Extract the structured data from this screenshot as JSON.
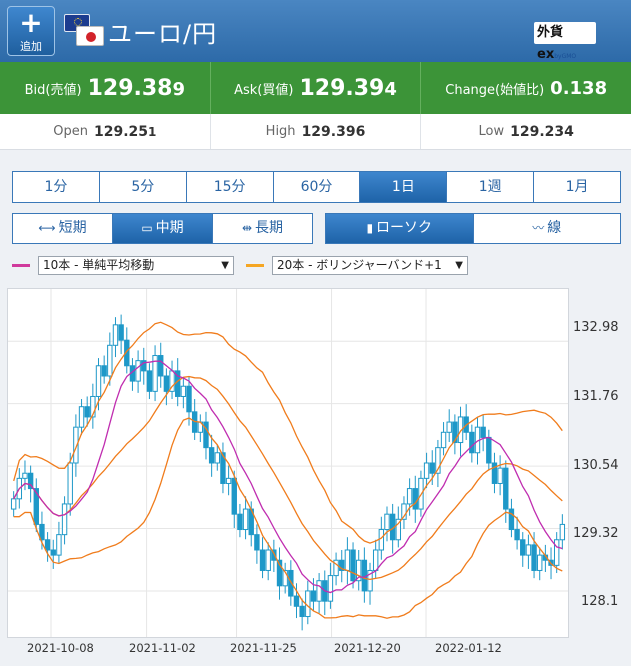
{
  "header": {
    "add_label": "追加",
    "title": "ユーロ/円",
    "brand": "外貨ex",
    "brand_sub": "byGMO"
  },
  "prices": {
    "bid_label": "Bid(売値)",
    "bid_main": "129.38",
    "bid_tail": "9",
    "ask_label": "Ask(買値)",
    "ask_main": "129.39",
    "ask_tail": "4",
    "change_label": "Change(始値比)",
    "change_value": "0.138",
    "open_label": "Open",
    "open_main": "129.25",
    "open_tail": "1",
    "high_label": "High",
    "high_value": "129.396",
    "low_label": "Low",
    "low_value": "129.234"
  },
  "timeframes": [
    "1分",
    "5分",
    "15分",
    "60分",
    "1日",
    "1週",
    "1月"
  ],
  "active_timeframe": "1日",
  "terms": {
    "short": "短期",
    "mid": "中期",
    "long": "長期",
    "active": "中期"
  },
  "chart_styles": {
    "candle": "ローソク",
    "line": "線",
    "active": "ローソク"
  },
  "indicators": [
    {
      "label": "10本 - 単純平均移動",
      "color": "#d03a9c"
    },
    {
      "label": "20本 - ボリンジャーバンド+1",
      "color": "#f5a623"
    }
  ],
  "colors": {
    "header": "#2d6aa8",
    "price_bar": "#3c9438",
    "candle": "#1e98c8",
    "sma": "#c02db0",
    "bollinger": "#f07c1c"
  },
  "chart_data": {
    "type": "candlestick",
    "y_ticks": [
      "132.98",
      "131.76",
      "130.54",
      "129.32",
      "128.1"
    ],
    "x_ticks": [
      "2021-10-08",
      "2021-11-02",
      "2021-11-25",
      "2021-12-20",
      "2022-01-12"
    ],
    "ylim": [
      127.2,
      134.0
    ],
    "close": [
      129.9,
      130.3,
      130.4,
      130.1,
      129.4,
      129.1,
      128.9,
      128.8,
      129.2,
      129.8,
      130.6,
      131.3,
      131.7,
      131.5,
      131.9,
      132.5,
      132.3,
      132.9,
      133.3,
      133.0,
      132.5,
      132.2,
      132.6,
      132.4,
      132.0,
      132.7,
      132.3,
      132.0,
      132.4,
      131.9,
      132.1,
      131.6,
      131.2,
      131.4,
      130.9,
      130.6,
      130.8,
      130.2,
      130.3,
      129.6,
      129.3,
      129.7,
      129.2,
      128.9,
      128.5,
      128.9,
      128.7,
      128.2,
      128.5,
      128.0,
      127.8,
      127.6,
      128.1,
      127.9,
      128.3,
      127.9,
      128.4,
      128.7,
      128.5,
      128.9,
      128.3,
      128.7,
      128.1,
      128.5,
      128.9,
      129.3,
      129.6,
      129.1,
      129.5,
      129.8,
      130.1,
      129.7,
      130.3,
      130.6,
      130.4,
      130.9,
      131.2,
      131.4,
      131.0,
      131.5,
      131.2,
      130.8,
      131.3,
      131.1,
      130.6,
      130.2,
      130.5,
      129.7,
      129.3,
      129.1,
      128.8,
      129.0,
      128.5,
      128.8,
      128.7,
      128.6,
      129.1,
      129.4
    ]
  }
}
